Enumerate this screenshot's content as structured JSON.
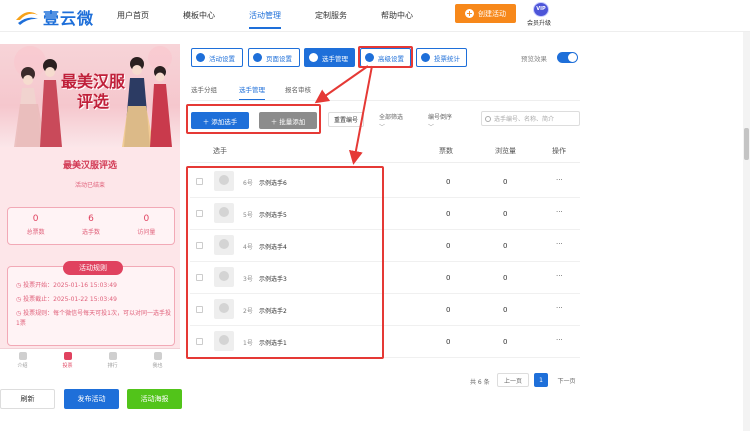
{
  "header": {
    "logo_text": "壹云微",
    "nav": [
      {
        "label": "用户首页",
        "active": false
      },
      {
        "label": "模板中心",
        "active": false
      },
      {
        "label": "活动管理",
        "active": true
      },
      {
        "label": "定制服务",
        "active": false
      },
      {
        "label": "帮助中心",
        "active": false
      }
    ],
    "create_label": "创建活动",
    "vip_badge": "VIP",
    "vip_label": "会员升级"
  },
  "preview": {
    "banner_title": "最美汉服评选",
    "activity_title": "最美汉服评选",
    "activity_status": "活动已结束",
    "stats": [
      {
        "value": "0",
        "label": "总票数"
      },
      {
        "value": "6",
        "label": "选手数"
      },
      {
        "value": "0",
        "label": "访问量"
      }
    ],
    "rules_tag": "活动规则",
    "rules": [
      "投票开始：2025-01-16 15:03:49",
      "投票截止：2025-01-22 15:03:49",
      "投票规则：每个微信号每天可投1次，可以对同一选手投1票"
    ],
    "tabs": [
      {
        "label": "介绍",
        "active": false
      },
      {
        "label": "投票",
        "active": true
      },
      {
        "label": "排行",
        "active": false
      },
      {
        "label": "我也",
        "active": false
      }
    ]
  },
  "bottom_buttons": {
    "refresh": "刷新",
    "publish": "发布活动",
    "poster": "活动海报"
  },
  "toolbar": {
    "buttons": [
      {
        "label": "活动设置",
        "active": false
      },
      {
        "label": "页面设置",
        "active": false
      },
      {
        "label": "选手管理",
        "active": true
      },
      {
        "label": "高级设置",
        "active": false
      },
      {
        "label": "投票统计",
        "active": false
      }
    ],
    "preview_label": "预览效果",
    "preview_on": true
  },
  "subtabs": [
    {
      "label": "选手分组",
      "active": false
    },
    {
      "label": "选手管理",
      "active": true
    },
    {
      "label": "报名审核",
      "active": false
    }
  ],
  "actions": {
    "add": "＋ 添加选手",
    "batch_add": "＋ 批量添加",
    "sort": "重置编号",
    "filter_all": "全部筛选",
    "order": "编号倒序",
    "search_placeholder": "选手编号、名称、简介"
  },
  "table": {
    "headers": {
      "name": "选手",
      "votes": "票数",
      "views": "浏览量",
      "ops": "操作"
    },
    "rows": [
      {
        "no": "6号",
        "name": "示例选手6",
        "votes": "0",
        "views": "0",
        "more": "···"
      },
      {
        "no": "5号",
        "name": "示例选手5",
        "votes": "0",
        "views": "0",
        "more": "···"
      },
      {
        "no": "4号",
        "name": "示例选手4",
        "votes": "0",
        "views": "0",
        "more": "···"
      },
      {
        "no": "3号",
        "name": "示例选手3",
        "votes": "0",
        "views": "0",
        "more": "···"
      },
      {
        "no": "2号",
        "name": "示例选手2",
        "votes": "0",
        "views": "0",
        "more": "···"
      },
      {
        "no": "1号",
        "name": "示例选手1",
        "votes": "0",
        "views": "0",
        "more": "···"
      }
    ]
  },
  "pager": {
    "total": "共 6 条",
    "prev": "上一页",
    "page": "1",
    "next": "下一页"
  },
  "colors": {
    "primary": "#1e6fd9",
    "orange": "#f7881a",
    "annotation_red": "#e53935",
    "green": "#52c41a",
    "pink": "#e0425f"
  }
}
